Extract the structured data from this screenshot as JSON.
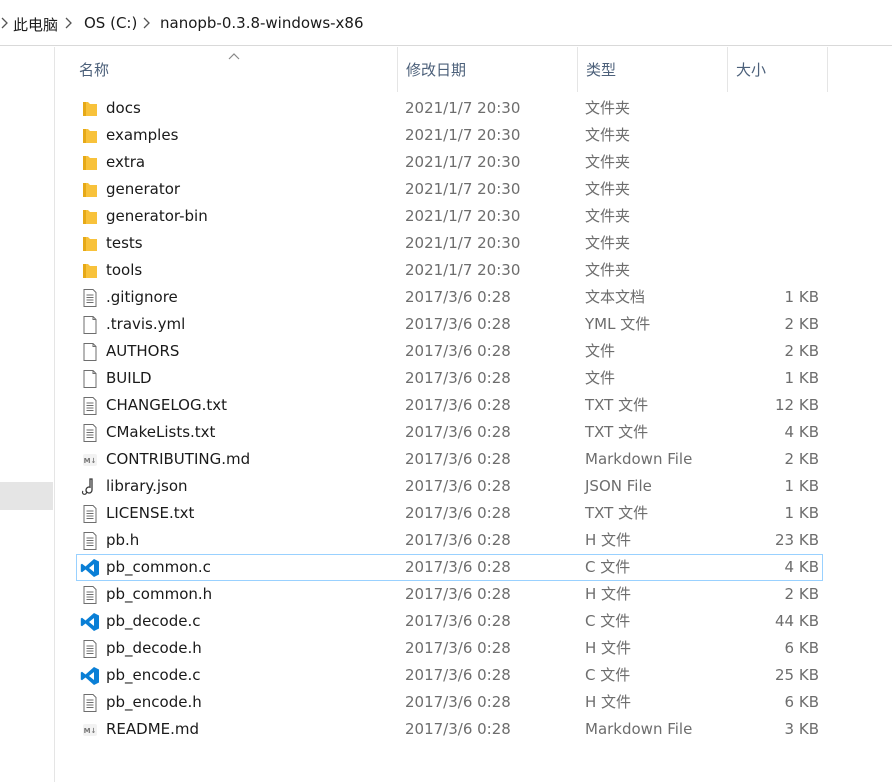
{
  "breadcrumb": [
    "此电脑",
    "OS (C:)",
    "nanopb-0.3.8-windows-x86"
  ],
  "columns": {
    "name": "名称",
    "date": "修改日期",
    "type": "类型",
    "size": "大小"
  },
  "files": [
    {
      "name": "docs",
      "date": "2021/1/7 20:30",
      "type": "文件夹",
      "size": "",
      "icon": "folder-icon"
    },
    {
      "name": "examples",
      "date": "2021/1/7 20:30",
      "type": "文件夹",
      "size": "",
      "icon": "folder-icon"
    },
    {
      "name": "extra",
      "date": "2021/1/7 20:30",
      "type": "文件夹",
      "size": "",
      "icon": "folder-icon"
    },
    {
      "name": "generator",
      "date": "2021/1/7 20:30",
      "type": "文件夹",
      "size": "",
      "icon": "folder-icon"
    },
    {
      "name": "generator-bin",
      "date": "2021/1/7 20:30",
      "type": "文件夹",
      "size": "",
      "icon": "folder-icon"
    },
    {
      "name": "tests",
      "date": "2021/1/7 20:30",
      "type": "文件夹",
      "size": "",
      "icon": "folder-icon"
    },
    {
      "name": "tools",
      "date": "2021/1/7 20:30",
      "type": "文件夹",
      "size": "",
      "icon": "folder-icon"
    },
    {
      "name": ".gitignore",
      "date": "2017/3/6 0:28",
      "type": "文本文档",
      "size": "1 KB",
      "icon": "text-file-icon"
    },
    {
      "name": ".travis.yml",
      "date": "2017/3/6 0:28",
      "type": "YML 文件",
      "size": "2 KB",
      "icon": "blank-file-icon"
    },
    {
      "name": "AUTHORS",
      "date": "2017/3/6 0:28",
      "type": "文件",
      "size": "2 KB",
      "icon": "blank-file-icon"
    },
    {
      "name": "BUILD",
      "date": "2017/3/6 0:28",
      "type": "文件",
      "size": "1 KB",
      "icon": "blank-file-icon"
    },
    {
      "name": "CHANGELOG.txt",
      "date": "2017/3/6 0:28",
      "type": "TXT 文件",
      "size": "12 KB",
      "icon": "text-file-icon"
    },
    {
      "name": "CMakeLists.txt",
      "date": "2017/3/6 0:28",
      "type": "TXT 文件",
      "size": "4 KB",
      "icon": "text-file-icon"
    },
    {
      "name": "CONTRIBUTING.md",
      "date": "2017/3/6 0:28",
      "type": "Markdown File",
      "size": "2 KB",
      "icon": "markdown-icon"
    },
    {
      "name": "library.json",
      "date": "2017/3/6 0:28",
      "type": "JSON File",
      "size": "1 KB",
      "icon": "json-file-icon"
    },
    {
      "name": "LICENSE.txt",
      "date": "2017/3/6 0:28",
      "type": "TXT 文件",
      "size": "1 KB",
      "icon": "text-file-icon"
    },
    {
      "name": "pb.h",
      "date": "2017/3/6 0:28",
      "type": "H 文件",
      "size": "23 KB",
      "icon": "text-file-icon"
    },
    {
      "name": "pb_common.c",
      "date": "2017/3/6 0:28",
      "type": "C 文件",
      "size": "4 KB",
      "icon": "vscode-icon"
    },
    {
      "name": "pb_common.h",
      "date": "2017/3/6 0:28",
      "type": "H 文件",
      "size": "2 KB",
      "icon": "text-file-icon"
    },
    {
      "name": "pb_decode.c",
      "date": "2017/3/6 0:28",
      "type": "C 文件",
      "size": "44 KB",
      "icon": "vscode-icon"
    },
    {
      "name": "pb_decode.h",
      "date": "2017/3/6 0:28",
      "type": "H 文件",
      "size": "6 KB",
      "icon": "text-file-icon"
    },
    {
      "name": "pb_encode.c",
      "date": "2017/3/6 0:28",
      "type": "C 文件",
      "size": "25 KB",
      "icon": "vscode-icon"
    },
    {
      "name": "pb_encode.h",
      "date": "2017/3/6 0:28",
      "type": "H 文件",
      "size": "6 KB",
      "icon": "text-file-icon"
    },
    {
      "name": "README.md",
      "date": "2017/3/6 0:28",
      "type": "Markdown File",
      "size": "3 KB",
      "icon": "markdown-icon"
    }
  ],
  "selected_file": "pb_common.c",
  "colors": {
    "folder": "#f8c23b",
    "vscode": "#0a7fd6",
    "header_text": "#4c607a",
    "selection_border": "#99d1ff"
  }
}
